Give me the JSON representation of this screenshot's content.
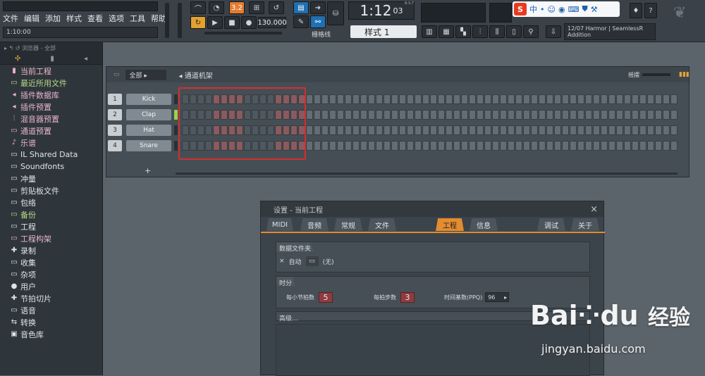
{
  "menu": [
    "文件",
    "编辑",
    "添加",
    "样式",
    "查看",
    "选项",
    "工具",
    "帮助"
  ],
  "hint_time": "1:10:00",
  "transport": {
    "time": "1:12",
    "time_sub": "03",
    "bst": "B:S:T",
    "tempo": "130.000",
    "pattern": "样式 1",
    "snap": "栅格线",
    "step_box": "3.2"
  },
  "news": {
    "date": "12/07",
    "text": "Harmor | SeamlessR",
    "sub": "Addition"
  },
  "ime": {
    "label": "中"
  },
  "browser": {
    "header": "浏览器 - 全部",
    "items": [
      {
        "label": "当前工程",
        "style": "hl",
        "icon": "▮"
      },
      {
        "label": "最近所用文件",
        "style": "gr",
        "icon": "▭"
      },
      {
        "label": "插件数据库",
        "style": "pl",
        "icon": "◂"
      },
      {
        "label": "插件预置",
        "style": "pl",
        "icon": "◂"
      },
      {
        "label": "混音器预置",
        "style": "pl",
        "icon": "⫶"
      },
      {
        "label": "通道预置",
        "style": "pl",
        "icon": "▭"
      },
      {
        "label": "乐谱",
        "style": "pl",
        "icon": "♪"
      },
      {
        "label": "IL Shared Data",
        "style": "wh",
        "icon": "▭"
      },
      {
        "label": "Soundfonts",
        "style": "wh",
        "icon": "▭"
      },
      {
        "label": "冲量",
        "style": "wh",
        "icon": "▭"
      },
      {
        "label": "剪贴板文件",
        "style": "wh",
        "icon": "▭"
      },
      {
        "label": "包络",
        "style": "wh",
        "icon": "▭"
      },
      {
        "label": "备份",
        "style": "gr",
        "icon": "▭"
      },
      {
        "label": "工程",
        "style": "wh",
        "icon": "▭"
      },
      {
        "label": "工程构架",
        "style": "pl",
        "icon": "▭"
      },
      {
        "label": "录制",
        "style": "wh",
        "icon": "✚"
      },
      {
        "label": "收集",
        "style": "wh",
        "icon": "▭"
      },
      {
        "label": "杂项",
        "style": "wh",
        "icon": "▭"
      },
      {
        "label": "用户",
        "style": "wh",
        "icon": "●"
      },
      {
        "label": "节拍切片",
        "style": "wh",
        "icon": "✚"
      },
      {
        "label": "语音",
        "style": "wh",
        "icon": "▭"
      },
      {
        "label": "转换",
        "style": "wh",
        "icon": "⇆"
      },
      {
        "label": "音色库",
        "style": "wh",
        "icon": "▣"
      }
    ]
  },
  "rack": {
    "filter": "全部",
    "title": "通道机架",
    "swing": "摇摆",
    "add": "+",
    "channels": [
      {
        "num": "1",
        "name": "Kick"
      },
      {
        "num": "2",
        "name": "Clap"
      },
      {
        "num": "3",
        "name": "Hat"
      },
      {
        "num": "4",
        "name": "Snare"
      }
    ]
  },
  "dialog": {
    "title": "设置 - 当前工程",
    "close": "×",
    "tabs": [
      "MIDI",
      "音频",
      "常规",
      "文件",
      "工程",
      "信息",
      "调试",
      "关于"
    ],
    "active_tab": "工程",
    "data_folder": {
      "title": "数据文件夹",
      "auto": "自动",
      "none": "(无)"
    },
    "timing": {
      "title": "时分",
      "beats_per_bar_label": "每小节拍数",
      "beats_per_bar": "5",
      "steps_per_beat_label": "每拍步数",
      "steps_per_beat": "3",
      "ppq_label": "时间基数(PPQ)",
      "ppq": "96"
    },
    "advanced": "高级..."
  },
  "watermark": {
    "brand": "Bai",
    "brand2": "du",
    "cn": "经验",
    "url": "jingyan.baidu.com"
  }
}
